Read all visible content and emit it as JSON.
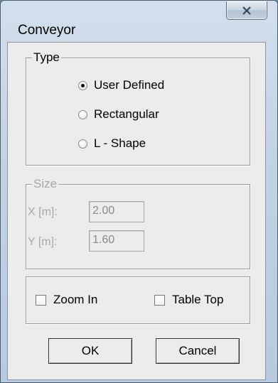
{
  "window": {
    "title": "Conveyor",
    "close_label": "✕"
  },
  "type_group": {
    "legend": "Type",
    "options": [
      {
        "label": "User Defined",
        "checked": true
      },
      {
        "label": "Rectangular",
        "checked": false
      },
      {
        "label": "L - Shape",
        "checked": false
      }
    ]
  },
  "size_group": {
    "legend": "Size",
    "x_label": "X [m]:",
    "x_value": "2.00",
    "y_label": "Y [m]:",
    "y_value": "1.60"
  },
  "options_group": {
    "zoom_in_label": "Zoom In",
    "zoom_in_checked": false,
    "table_top_label": "Table Top",
    "table_top_checked": false
  },
  "buttons": {
    "ok_label": "OK",
    "cancel_label": "Cancel"
  }
}
